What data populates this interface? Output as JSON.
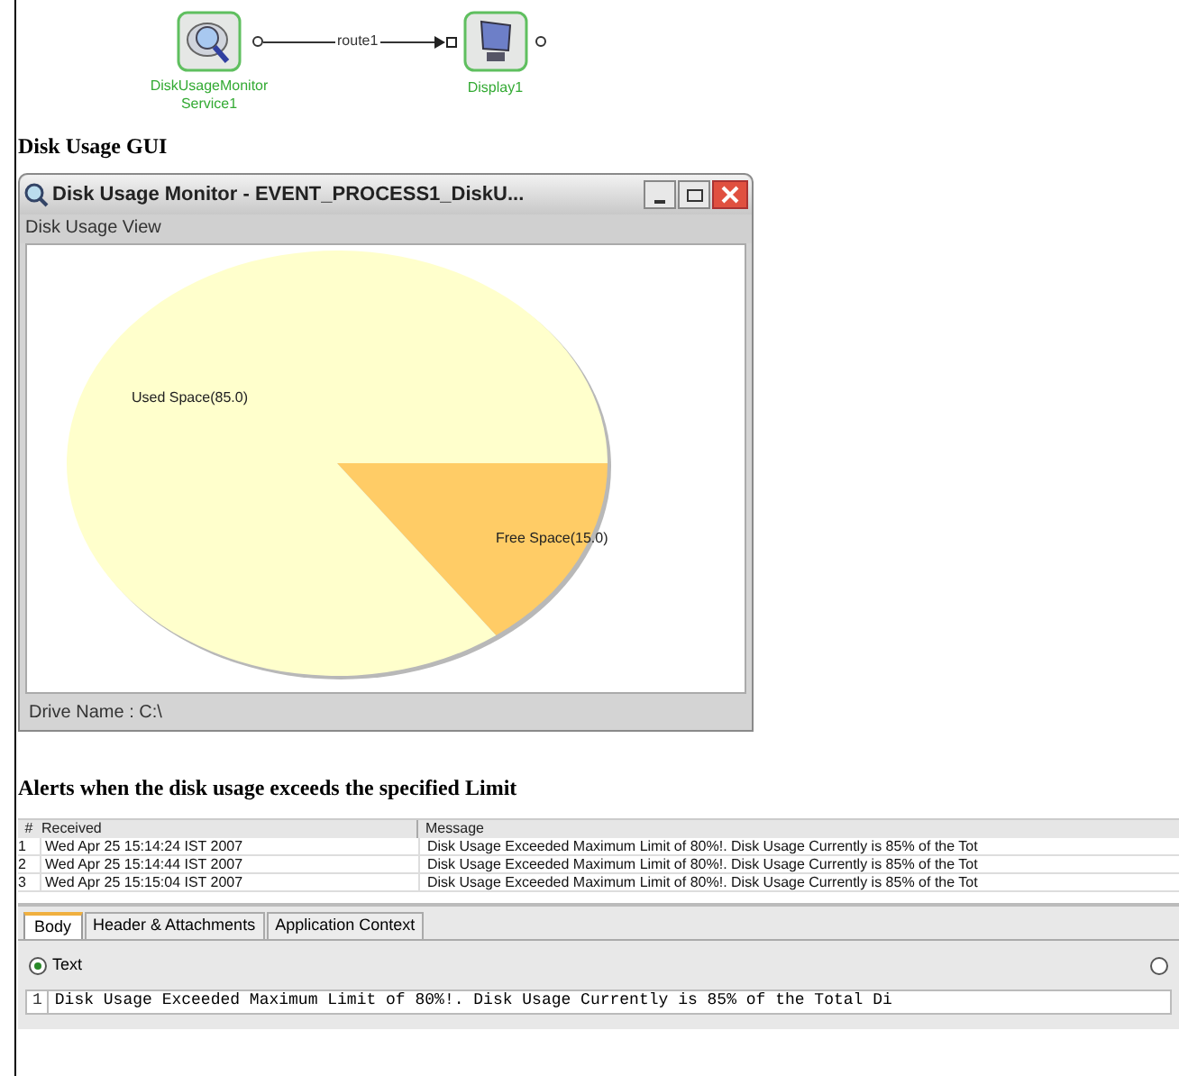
{
  "diagram": {
    "nodes": [
      {
        "label": "DiskUsageMonitorService1",
        "kind": "monitor"
      },
      {
        "label": "Display1",
        "kind": "display"
      }
    ],
    "route": {
      "label": "route1"
    }
  },
  "heading_gui": "Disk Usage GUI",
  "window": {
    "title": "Disk Usage Monitor - EVENT_PROCESS1_DiskU...",
    "view_label": "Disk Usage View",
    "footer": "Drive Name : C:\\",
    "chart_data": {
      "type": "pie",
      "categories": [
        "Used Space(85.0)",
        "Free Space(15.0)"
      ],
      "values": [
        85.0,
        15.0
      ]
    }
  },
  "heading_alerts": "Alerts when the disk usage exceeds the specified Limit",
  "table": {
    "columns": [
      "#",
      "Received",
      "Message"
    ],
    "rows": [
      {
        "cells": [
          "1",
          "Wed Apr 25 15:14:24 IST 2007",
          "Disk Usage Exceeded Maximum Limit of 80%!. Disk Usage Currently is 85% of the Tot"
        ]
      },
      {
        "cells": [
          "2",
          "Wed Apr 25 15:14:44 IST 2007",
          "Disk Usage Exceeded Maximum Limit of 80%!. Disk Usage Currently is 85% of the Tot"
        ]
      },
      {
        "cells": [
          "3",
          "Wed Apr 25 15:15:04 IST 2007",
          "Disk Usage Exceeded Maximum Limit of 80%!. Disk Usage Currently is 85% of the Tot"
        ]
      }
    ]
  },
  "tabs": [
    {
      "label": "Body",
      "selected": true
    },
    {
      "label": "Header & Attachments",
      "selected": false
    },
    {
      "label": "Application Context",
      "selected": false
    }
  ],
  "format_options": [
    {
      "label": "Text",
      "selected": true
    },
    {
      "selected": false
    }
  ],
  "body_lines": [
    {
      "number": "1",
      "text": "Disk Usage Exceeded Maximum Limit of 80%!. Disk Usage Currently is 85% of the Total Di"
    }
  ]
}
